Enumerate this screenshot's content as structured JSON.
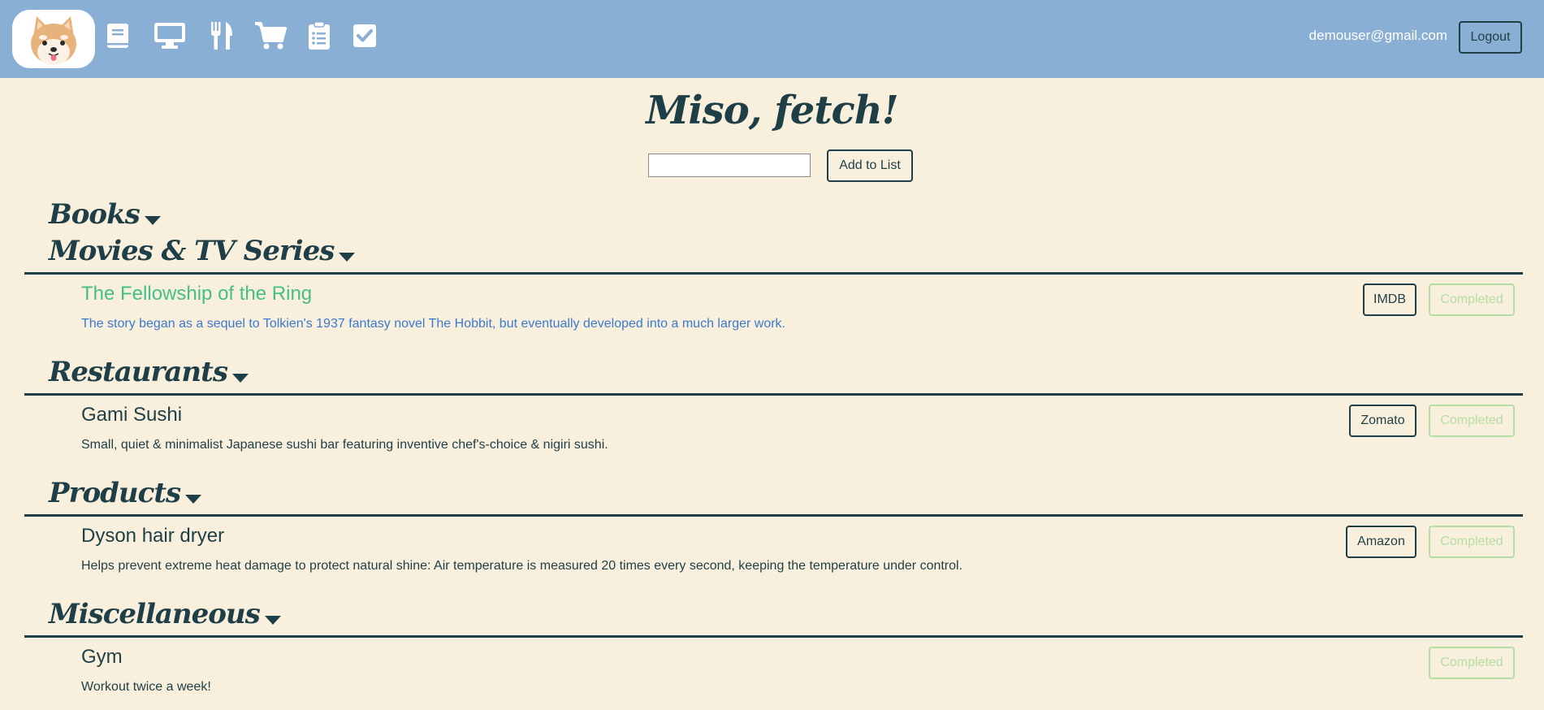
{
  "navbar": {
    "icons": [
      "book-icon",
      "desktop-icon",
      "utensils-icon",
      "cart-icon",
      "clipboard-icon",
      "checkbox-icon"
    ],
    "user_email": "demouser@gmail.com",
    "logout_label": "Logout"
  },
  "main": {
    "title": "Miso, fetch!",
    "input_value": "",
    "add_label": "Add to List"
  },
  "categories": [
    {
      "name": "Books",
      "expanded": false,
      "items": []
    },
    {
      "name": "Movies & TV Series",
      "expanded": true,
      "items": [
        {
          "title": "The Fellowship of the Ring",
          "description": "The story began as a sequel to Tolkien's 1937 fantasy novel The Hobbit, but eventually developed into a much larger work.",
          "link_label": "IMDB",
          "completed_label": "Completed"
        }
      ]
    },
    {
      "name": "Restaurants",
      "expanded": true,
      "items": [
        {
          "title": "Gami Sushi",
          "description": "Small, quiet & minimalist Japanese sushi bar featuring inventive chef's-choice & nigiri sushi.",
          "link_label": "Zomato",
          "completed_label": "Completed"
        }
      ]
    },
    {
      "name": "Products",
      "expanded": true,
      "items": [
        {
          "title": "Dyson hair dryer",
          "description": "Helps prevent extreme heat damage to protect natural shine: Air temperature is measured 20 times every second, keeping the temperature under control.",
          "link_label": "Amazon",
          "completed_label": "Completed"
        }
      ]
    },
    {
      "name": "Miscellaneous",
      "expanded": true,
      "items": [
        {
          "title": "Gym",
          "description": "Workout twice a week!",
          "completed_label": "Completed"
        }
      ]
    }
  ],
  "colors": {
    "navbar": "#8aafd5",
    "background": "#f8efdc",
    "text": "#1e3f47",
    "accent_title": "#45bf8a",
    "accent_desc": "#3b7ad1",
    "completed": "#b4dea3"
  }
}
